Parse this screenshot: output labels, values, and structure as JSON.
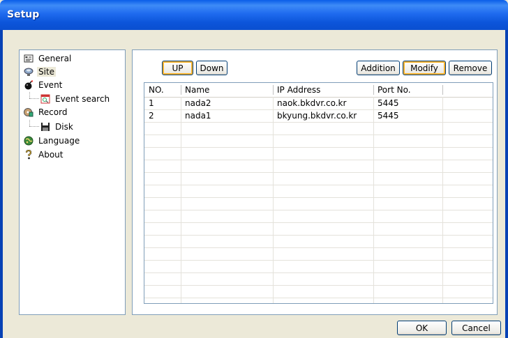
{
  "window": {
    "title": "Setup"
  },
  "tree": {
    "items": [
      {
        "label": "General",
        "icon": "general-icon"
      },
      {
        "label": "Site",
        "icon": "site-icon"
      },
      {
        "label": "Event",
        "icon": "event-icon"
      },
      {
        "label": "Event search",
        "icon": "event-search-icon"
      },
      {
        "label": "Record",
        "icon": "record-icon"
      },
      {
        "label": "Disk",
        "icon": "disk-icon"
      },
      {
        "label": "Language",
        "icon": "language-icon"
      },
      {
        "label": "About",
        "icon": "about-icon"
      }
    ]
  },
  "toolbar": {
    "up": "UP",
    "down": "Down",
    "addition": "Addition",
    "modify": "Modify",
    "remove": "Remove"
  },
  "table": {
    "columns": [
      "NO.",
      "Name",
      "IP Address",
      "Port No."
    ],
    "rows": [
      [
        "1",
        "nada2",
        "naok.bkdvr.co.kr",
        "5445"
      ],
      [
        "2",
        "nada1",
        "bkyung.bkdvr.co.kr",
        "5445"
      ]
    ]
  },
  "footer": {
    "ok": "OK",
    "cancel": "Cancel"
  }
}
